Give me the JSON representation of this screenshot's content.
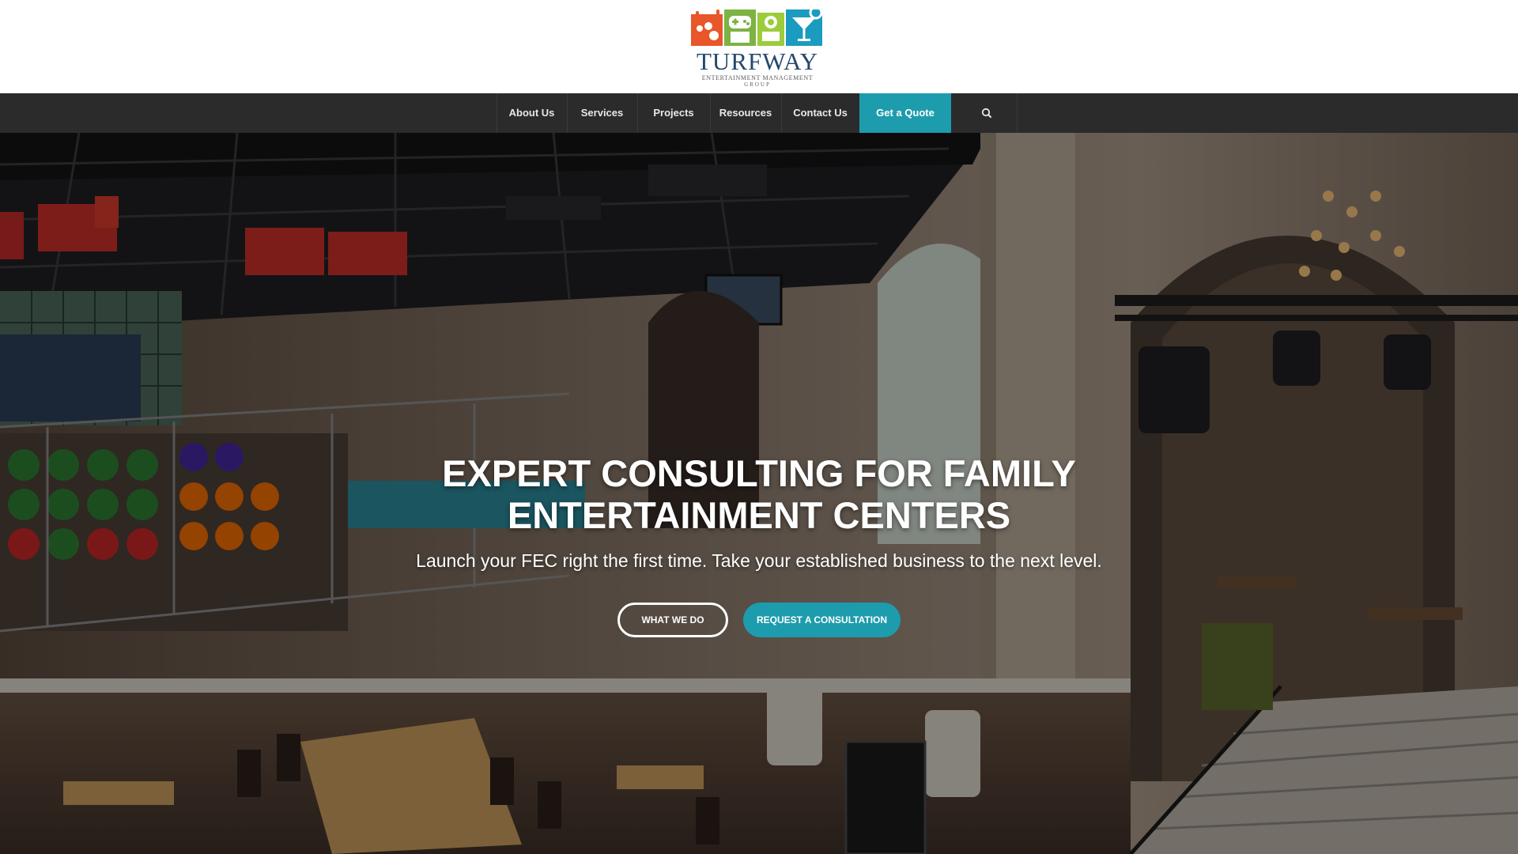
{
  "header": {
    "logo": {
      "name": "TURFWAY",
      "tagline": "ENTERTAINMENT MANAGEMENT",
      "tagline2": "GROUP",
      "icons": [
        "bowling-icon",
        "game-controller-icon",
        "arcade-icon",
        "cocktail-icon"
      ]
    }
  },
  "nav": {
    "items": [
      {
        "label": "About Us"
      },
      {
        "label": "Services"
      },
      {
        "label": "Projects"
      },
      {
        "label": "Resources"
      },
      {
        "label": "Contact Us"
      },
      {
        "label": "Get a Quote"
      }
    ],
    "search_icon": "search-icon"
  },
  "hero": {
    "title_line1": "EXPERT CONSULTING FOR FAMILY",
    "title_line2": "ENTERTAINMENT CENTERS",
    "subtitle": "Launch your FEC right the first time. Take your established business to the next level.",
    "buttons": [
      {
        "label": "WHAT WE DO"
      },
      {
        "label": "REQUEST A CONSULTATION"
      }
    ]
  },
  "colors": {
    "accent": "#1d9cad",
    "nav_bg": "#2b2b2b",
    "logo_orange": "#e8562a",
    "logo_green": "#7cb342",
    "logo_blue": "#1b9bbf",
    "logo_text": "#24486b"
  }
}
